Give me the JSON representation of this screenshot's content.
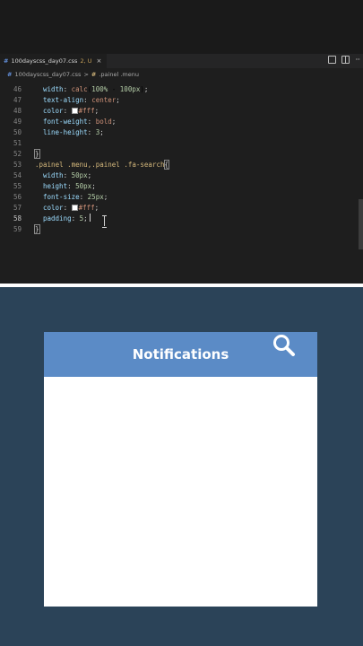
{
  "editor": {
    "tab": {
      "icon": "#",
      "filename": "100dayscss_day07.css",
      "status": "2, U",
      "close_glyph": "×"
    },
    "breadcrumb": {
      "file": "100dayscss_day07.css",
      "separator": ">",
      "symbol": ".painel .menu"
    },
    "lines": [
      {
        "n": "46",
        "text": "width: calc(100% - 100px);"
      },
      {
        "n": "47",
        "text": "text-align: center;"
      },
      {
        "n": "48",
        "text": "color: #fff;"
      },
      {
        "n": "49",
        "text": "font-weight: bold;"
      },
      {
        "n": "50",
        "text": "line-height: 3;"
      },
      {
        "n": "51",
        "text": ""
      },
      {
        "n": "52",
        "text": "}"
      },
      {
        "n": "53",
        "text": ".painel .menu,.painel .fa-search{"
      },
      {
        "n": "54",
        "text": "width: 50px;"
      },
      {
        "n": "55",
        "text": "height: 50px;"
      },
      {
        "n": "56",
        "text": "font-size: 25px;"
      },
      {
        "n": "57",
        "text": "color: #fff;"
      },
      {
        "n": "58",
        "text": "padding: 5;"
      },
      {
        "n": "59",
        "text": "}"
      }
    ],
    "active_line": "58"
  },
  "preview": {
    "panel_title": "Notifications",
    "search_icon": "search-icon"
  },
  "colors": {
    "preview_bg": "#2b4358",
    "header_bg": "#5b8bc6",
    "panel_bg": "#ffffff"
  }
}
